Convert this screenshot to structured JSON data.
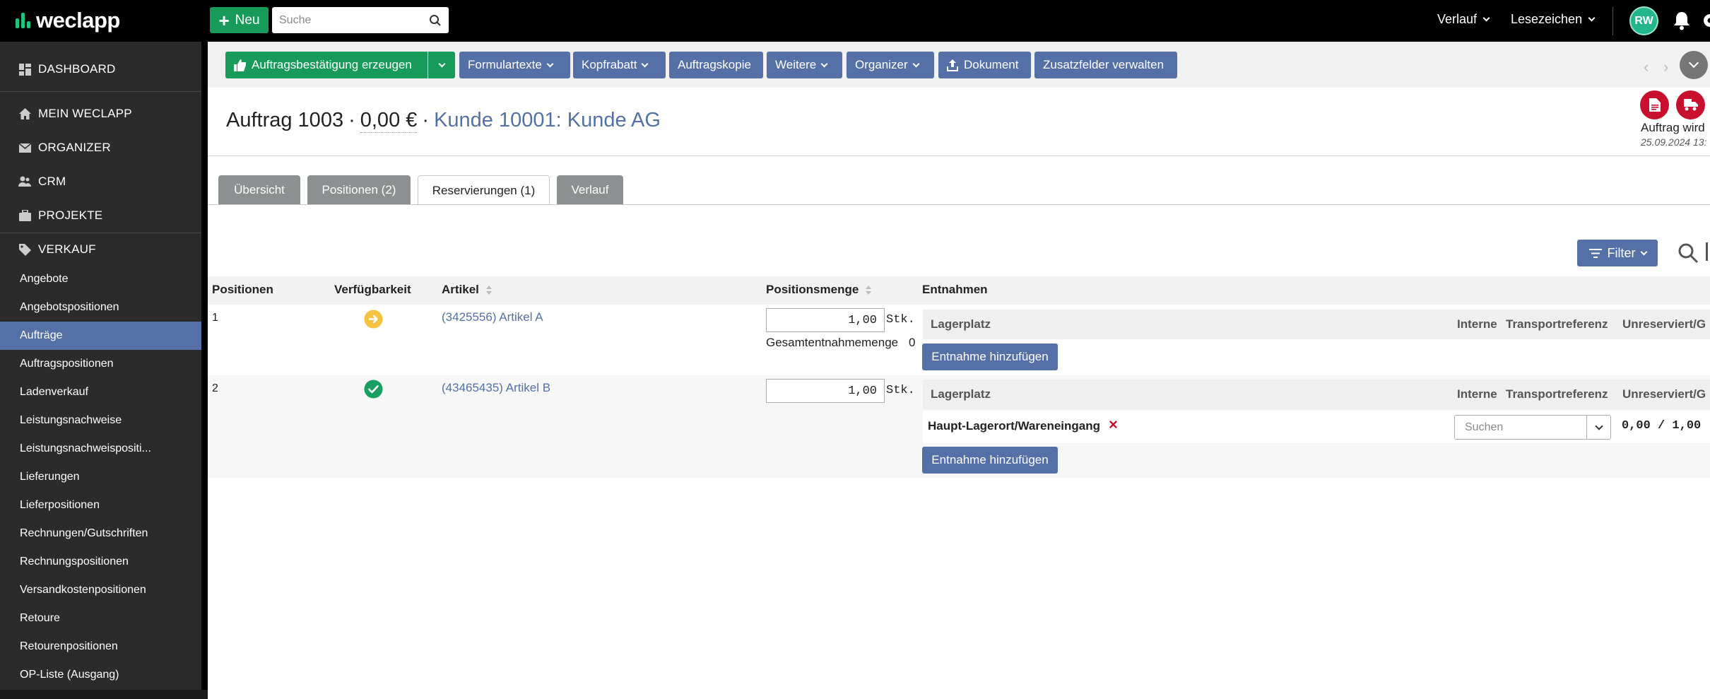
{
  "app": {
    "logo_text": "weclapp",
    "new_button": "Neu",
    "search_placeholder": "Suche",
    "history": "Verlauf",
    "bookmarks": "Lesezeichen",
    "user_initials": "RW"
  },
  "sidebar": {
    "main_items": [
      {
        "label": "DASHBOARD",
        "icon": "dashboard-icon"
      },
      {
        "label": "MEIN WECLAPP",
        "icon": "home-icon"
      },
      {
        "label": "ORGANIZER",
        "icon": "mail-icon"
      },
      {
        "label": "CRM",
        "icon": "users-icon"
      },
      {
        "label": "PROJEKTE",
        "icon": "briefcase-icon"
      },
      {
        "label": "VERKAUF",
        "icon": "tag-icon"
      }
    ],
    "sub_items": [
      "Angebote",
      "Angebotspositionen",
      "Aufträge",
      "Auftragspositionen",
      "Ladenverkauf",
      "Leistungsnachweise",
      "Leistungsnachweispositi...",
      "Lieferungen",
      "Lieferpositionen",
      "Rechnungen/Gutschriften",
      "Rechnungspositionen",
      "Versandkostenpositionen",
      "Retoure",
      "Retourenpositionen",
      "OP-Liste (Ausgang)"
    ],
    "active_sub": "Aufträge"
  },
  "toolbar": {
    "confirm": "Auftragsbestätigung erzeugen",
    "form_texts": "Formulartexte",
    "header_discount": "Kopfrabatt",
    "order_copy": "Auftragskopie",
    "more": "Weitere",
    "organizer": "Organizer",
    "document": "Dokument",
    "extra_fields": "Zusatzfelder verwalten"
  },
  "header": {
    "order": "Auftrag 1003",
    "amount": "0,00 €",
    "customer": "Kunde 10001: Kunde AG",
    "status": "Auftrag wird",
    "status_date": "25.09.2024 13:"
  },
  "tabs": [
    {
      "label": "Übersicht",
      "active": false
    },
    {
      "label": "Positionen (2)",
      "active": false
    },
    {
      "label": "Reservierungen (1)",
      "active": true
    },
    {
      "label": "Verlauf",
      "active": false
    }
  ],
  "filter": {
    "label": "Filter"
  },
  "table": {
    "headers": {
      "positions": "Positionen",
      "availability": "Verfügbarkeit",
      "article": "Artikel",
      "quantity": "Positionsmenge",
      "withdrawals": "Entnahmen"
    },
    "sub_headers": {
      "storage": "Lagerplatz",
      "internal": "Interne",
      "transport": "Transportreferenz",
      "unreserved": "Unreserviert/G"
    },
    "rows": [
      {
        "pos": "1",
        "availability": "partial",
        "article": "(3425556) Artikel A",
        "quantity": "1,00",
        "unit": "Stk.",
        "total_label": "Gesamtentnahmemenge",
        "total_value": "0"
      },
      {
        "pos": "2",
        "availability": "available",
        "article": "(43465435) Artikel B",
        "quantity": "1,00",
        "unit": "Stk.",
        "storage_location": "Haupt-Lagerort/Wareneingang",
        "search_placeholder": "Suchen",
        "reserved": "0,00 / 1,00"
      }
    ],
    "add_withdrawal": "Entnahme hinzufügen"
  },
  "colors": {
    "green": "#189b5a",
    "blue": "#5470a6",
    "sidebar": "#2b2b2b",
    "red": "#c8102e",
    "available": "#1b9e62",
    "partial": "#f5c342"
  }
}
